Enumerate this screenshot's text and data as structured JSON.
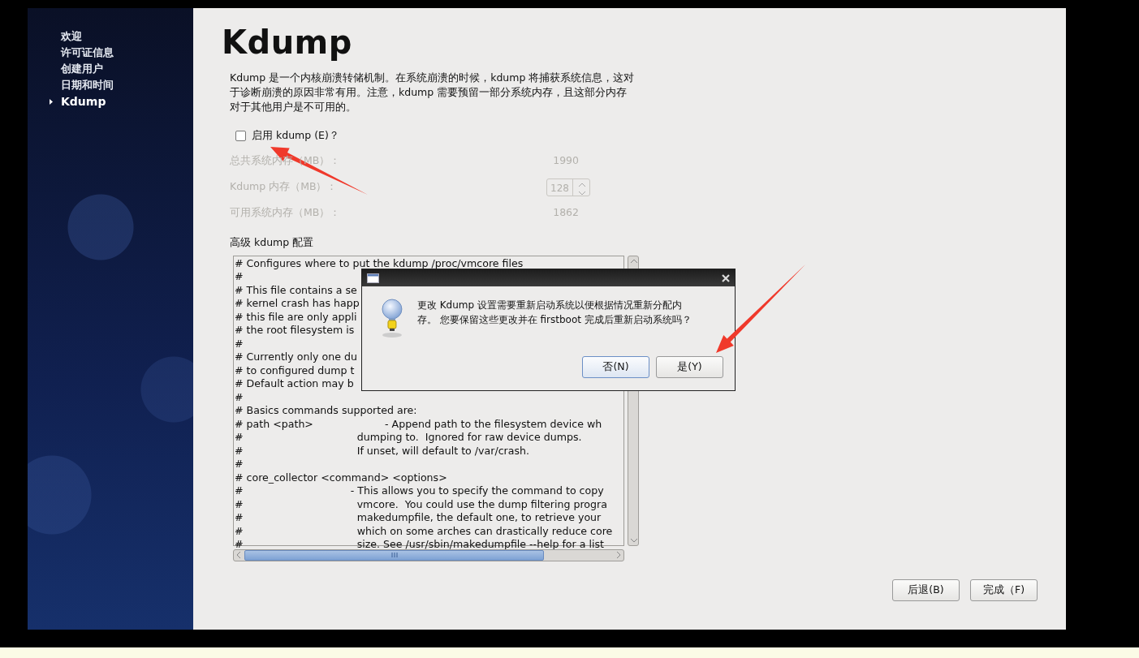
{
  "sidebar": {
    "items": [
      {
        "label": "欢迎",
        "selected": false
      },
      {
        "label": "许可证信息",
        "selected": false
      },
      {
        "label": "创建用户",
        "selected": false
      },
      {
        "label": "日期和时间",
        "selected": false
      },
      {
        "label": "Kdump",
        "selected": true
      }
    ]
  },
  "page": {
    "title": "Kdump",
    "description": "Kdump 是一个内核崩溃转储机制。在系统崩溃的时候，kdump 将捕获系统信息，这对于诊断崩溃的原因非常有用。注意，kdump 需要预留一部分系统内存，且这部分内存对于其他用户是不可用的。",
    "enable": {
      "label": "启用 kdump (E)？",
      "checked": false
    },
    "memory_rows": [
      {
        "kind": "text",
        "label": "总共系统内存（MB）：",
        "value": "1990",
        "disabled": true
      },
      {
        "kind": "spin",
        "label": "Kdump 内存（MB）：",
        "value": "128",
        "disabled": true
      },
      {
        "kind": "text",
        "label": "可用系统内存（MB）：",
        "value": "1862",
        "disabled": true
      }
    ],
    "advanced": {
      "label": "高级 kdump 配置",
      "lines": [
        "# Configures where to put the kdump /proc/vmcore files",
        "#",
        "# This file contains a se",
        "# kernel crash has happ",
        "# this file are only appli",
        "# the root filesystem is",
        "#",
        "# Currently only one du",
        "# to configured dump t",
        "# Default action may b",
        "#",
        "# Basics commands supported are:",
        "# path <path>                      - Append path to the filesystem device wh",
        "#                                   dumping to.  Ignored for raw device dumps.",
        "#                                   If unset, will default to /var/crash.",
        "#",
        "# core_collector <command> <options>",
        "#                                 - This allows you to specify the command to copy",
        "#                                   vmcore.  You could use the dump filtering progra",
        "#                                   makedumpfile, the default one, to retrieve your",
        "#                                   which on some arches can drastically reduce core",
        "#                                   size. See /usr/sbin/makedumpfile --help for a list"
      ]
    },
    "buttons": [
      {
        "label": "后退(B)"
      },
      {
        "label": "完成（F)"
      }
    ]
  },
  "dialog": {
    "message_lines": [
      "更改 Kdump 设置需要重新启动系统以便根据情况重新分配内",
      "存。 您要保留这些更改并在 firstboot 完成后重新启动系统吗？"
    ],
    "buttons": [
      {
        "label": "否(N)",
        "focused": true
      },
      {
        "label": "是(Y)",
        "focused": false
      }
    ]
  }
}
